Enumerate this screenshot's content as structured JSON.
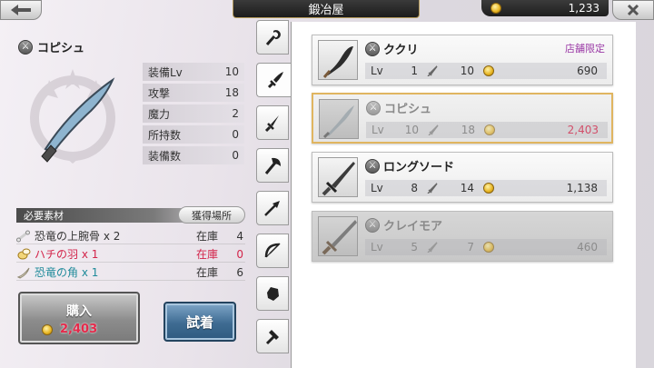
{
  "header": {
    "title": "鍛冶屋",
    "gold": "1,233",
    "back_icon": "arrow-left-icon",
    "close_icon": "close-icon"
  },
  "selected_weapon": {
    "name": "コピシュ",
    "stats": [
      {
        "label": "装備Lv",
        "value": "10"
      },
      {
        "label": "攻撃",
        "value": "18"
      },
      {
        "label": "魔力",
        "value": "2"
      },
      {
        "label": "所持数",
        "value": "0"
      },
      {
        "label": "装備数",
        "value": "0"
      }
    ]
  },
  "materials": {
    "heading": "必要素材",
    "acquire_button": "獲得場所",
    "items": [
      {
        "name": "恐竜の上腕骨 x 2",
        "stock_label": "在庫",
        "count": "4",
        "color": "#333333",
        "count_color": "#333333"
      },
      {
        "name": "ハチの羽 x 1",
        "stock_label": "在庫",
        "count": "0",
        "color": "#d3244a",
        "count_color": "#d3244a"
      },
      {
        "name": "恐竜の角 x 1",
        "stock_label": "在庫",
        "count": "6",
        "color": "#1f8a9a",
        "count_color": "#333333"
      }
    ]
  },
  "actions": {
    "buy_label": "購入",
    "buy_price": "2,403",
    "try_label": "試着"
  },
  "tabs": [
    {
      "icon": "staff-icon"
    },
    {
      "icon": "sword-icon",
      "active": true
    },
    {
      "icon": "dagger-icon"
    },
    {
      "icon": "axe-icon"
    },
    {
      "icon": "spear-icon"
    },
    {
      "icon": "bow-icon"
    },
    {
      "icon": "gauntlet-icon"
    },
    {
      "icon": "hammer-icon"
    }
  ],
  "weapons": [
    {
      "name": "ククリ",
      "badge": "店舗限定",
      "lv_label": "Lv",
      "lv": "1",
      "atk": "10",
      "price": "690",
      "state": "normal"
    },
    {
      "name": "コピシュ",
      "badge": "",
      "lv_label": "Lv",
      "lv": "10",
      "atk": "18",
      "price": "2,403",
      "state": "selected"
    },
    {
      "name": "ロングソード",
      "badge": "",
      "lv_label": "Lv",
      "lv": "8",
      "atk": "14",
      "price": "1,138",
      "state": "normal"
    },
    {
      "name": "クレイモア",
      "badge": "",
      "lv_label": "Lv",
      "lv": "5",
      "atk": "7",
      "price": "460",
      "state": "dim"
    }
  ]
}
